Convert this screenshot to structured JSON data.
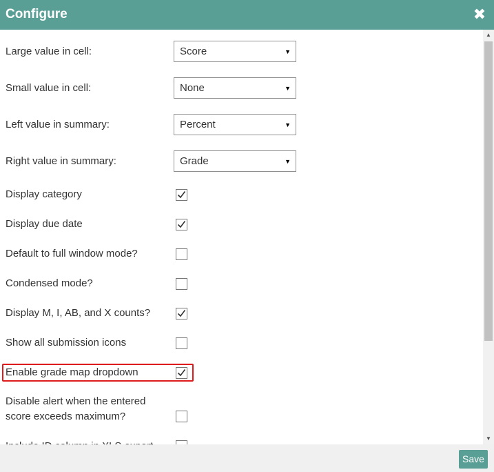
{
  "dialog": {
    "title": "Configure",
    "close_icon": "close-icon"
  },
  "selects": [
    {
      "label": "Large value in cell:",
      "value": "Score"
    },
    {
      "label": "Small value in cell:",
      "value": "None"
    },
    {
      "label": "Left value in summary:",
      "value": "Percent"
    },
    {
      "label": "Right value in summary:",
      "value": "Grade"
    }
  ],
  "options": [
    {
      "label": "Display category",
      "checked": true
    },
    {
      "label": "Display due date",
      "checked": true
    },
    {
      "label": "Default to full window mode?",
      "checked": false
    },
    {
      "label": "Condensed mode?",
      "checked": false
    },
    {
      "label": "Display M, I, AB, and X counts?",
      "checked": true
    },
    {
      "label": "Show all submission icons",
      "checked": false
    },
    {
      "label": "Enable grade map dropdown",
      "checked": true,
      "highlighted": true
    },
    {
      "label_line1": "Disable alert when the entered",
      "label_line2": "score exceeds maximum?",
      "checked": false
    },
    {
      "label": "Include ID column in XLS export",
      "checked": false
    }
  ],
  "footer": {
    "save_label": "Save"
  },
  "colors": {
    "accent": "#5a9f96",
    "highlight_border": "#e01a1a",
    "footer_bg": "#f0f0f0"
  }
}
